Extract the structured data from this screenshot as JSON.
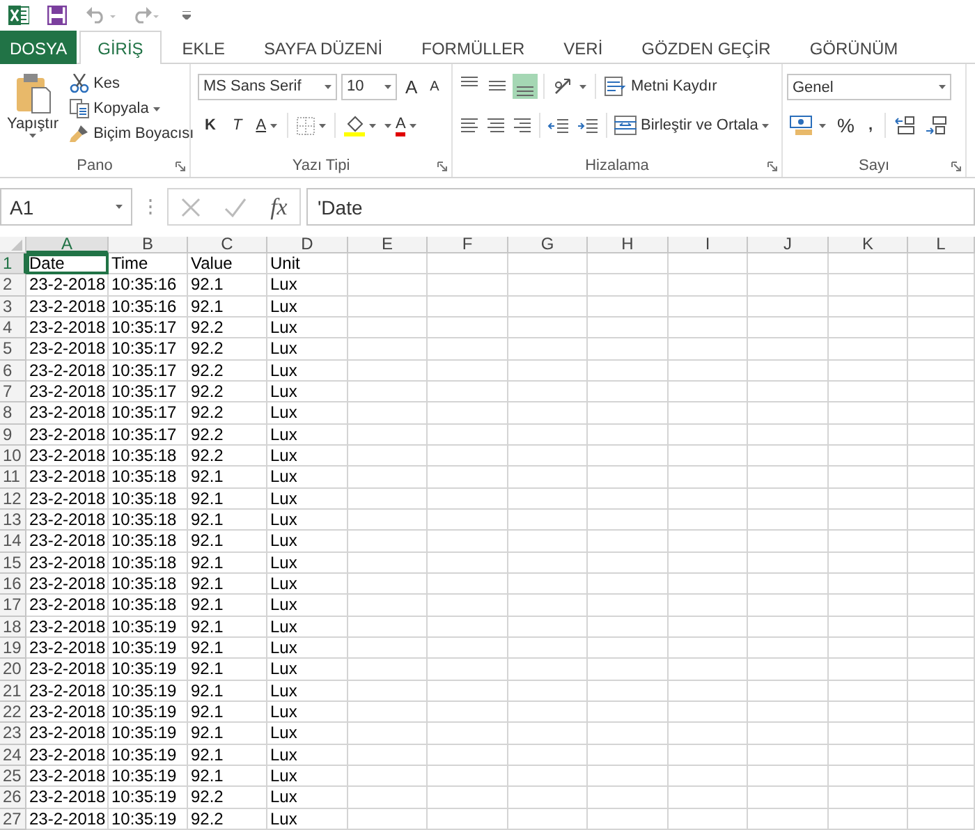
{
  "tabs": [
    {
      "label": "DOSYA",
      "kind": "file",
      "selected": false
    },
    {
      "label": "GİRİŞ",
      "kind": "tab",
      "selected": true
    },
    {
      "label": "EKLE",
      "kind": "tab",
      "selected": false
    },
    {
      "label": "SAYFA DÜZENİ",
      "kind": "tab",
      "selected": false
    },
    {
      "label": "FORMÜLLER",
      "kind": "tab",
      "selected": false
    },
    {
      "label": "VERİ",
      "kind": "tab",
      "selected": false
    },
    {
      "label": "GÖZDEN GEÇİR",
      "kind": "tab",
      "selected": false
    },
    {
      "label": "GÖRÜNÜM",
      "kind": "tab",
      "selected": false
    }
  ],
  "ribbon": {
    "clipboard": {
      "label": "Pano",
      "paste": "Yapıştır",
      "cut": "Kes",
      "copy": "Kopyala",
      "format_painter": "Biçim Boyacısı"
    },
    "font": {
      "label": "Yazı Tipi",
      "font_name": "MS Sans Serif",
      "font_size": "10",
      "grow_font": "A",
      "shrink_font": "A",
      "bold": "K",
      "italic": "T",
      "underline": "A",
      "font_color": "A"
    },
    "alignment": {
      "label": "Hizalama",
      "vertical_align": [
        {
          "kind": "top",
          "selected": false
        },
        {
          "kind": "middle",
          "selected": false
        },
        {
          "kind": "bottom",
          "selected": true
        }
      ],
      "wrap_text": "Metni Kaydır",
      "merge_center": "Birleştir ve Ortala"
    },
    "number": {
      "label": "Sayı",
      "format": "Genel",
      "percent": "%",
      "comma": ","
    }
  },
  "formula_bar": {
    "name_box": "A1",
    "function_label": "fx",
    "formula": "'Date"
  },
  "sheet": {
    "columns": [
      {
        "label": "A",
        "selected": true
      },
      {
        "label": "B",
        "selected": false
      },
      {
        "label": "C",
        "selected": false
      },
      {
        "label": "D",
        "selected": false
      },
      {
        "label": "E",
        "selected": false
      },
      {
        "label": "F",
        "selected": false
      },
      {
        "label": "G",
        "selected": false
      },
      {
        "label": "H",
        "selected": false
      },
      {
        "label": "I",
        "selected": false
      },
      {
        "label": "J",
        "selected": false
      },
      {
        "label": "K",
        "selected": false
      },
      {
        "label": "L",
        "selected": false
      }
    ],
    "rows": [
      {
        "number": "1",
        "selected": true,
        "cells": [
          "Date",
          "Time",
          "Value",
          "Unit"
        ]
      },
      {
        "number": "2",
        "selected": false,
        "cells": [
          "23-2-2018",
          "10:35:16",
          "92.1",
          "Lux"
        ]
      },
      {
        "number": "3",
        "selected": false,
        "cells": [
          "23-2-2018",
          "10:35:16",
          "92.1",
          "Lux"
        ]
      },
      {
        "number": "4",
        "selected": false,
        "cells": [
          "23-2-2018",
          "10:35:17",
          "92.2",
          "Lux"
        ]
      },
      {
        "number": "5",
        "selected": false,
        "cells": [
          "23-2-2018",
          "10:35:17",
          "92.2",
          "Lux"
        ]
      },
      {
        "number": "6",
        "selected": false,
        "cells": [
          "23-2-2018",
          "10:35:17",
          "92.2",
          "Lux"
        ]
      },
      {
        "number": "7",
        "selected": false,
        "cells": [
          "23-2-2018",
          "10:35:17",
          "92.2",
          "Lux"
        ]
      },
      {
        "number": "8",
        "selected": false,
        "cells": [
          "23-2-2018",
          "10:35:17",
          "92.2",
          "Lux"
        ]
      },
      {
        "number": "9",
        "selected": false,
        "cells": [
          "23-2-2018",
          "10:35:17",
          "92.2",
          "Lux"
        ]
      },
      {
        "number": "10",
        "selected": false,
        "cells": [
          "23-2-2018",
          "10:35:18",
          "92.2",
          "Lux"
        ]
      },
      {
        "number": "11",
        "selected": false,
        "cells": [
          "23-2-2018",
          "10:35:18",
          "92.1",
          "Lux"
        ]
      },
      {
        "number": "12",
        "selected": false,
        "cells": [
          "23-2-2018",
          "10:35:18",
          "92.1",
          "Lux"
        ]
      },
      {
        "number": "13",
        "selected": false,
        "cells": [
          "23-2-2018",
          "10:35:18",
          "92.1",
          "Lux"
        ]
      },
      {
        "number": "14",
        "selected": false,
        "cells": [
          "23-2-2018",
          "10:35:18",
          "92.1",
          "Lux"
        ]
      },
      {
        "number": "15",
        "selected": false,
        "cells": [
          "23-2-2018",
          "10:35:18",
          "92.1",
          "Lux"
        ]
      },
      {
        "number": "16",
        "selected": false,
        "cells": [
          "23-2-2018",
          "10:35:18",
          "92.1",
          "Lux"
        ]
      },
      {
        "number": "17",
        "selected": false,
        "cells": [
          "23-2-2018",
          "10:35:18",
          "92.1",
          "Lux"
        ]
      },
      {
        "number": "18",
        "selected": false,
        "cells": [
          "23-2-2018",
          "10:35:19",
          "92.1",
          "Lux"
        ]
      },
      {
        "number": "19",
        "selected": false,
        "cells": [
          "23-2-2018",
          "10:35:19",
          "92.1",
          "Lux"
        ]
      },
      {
        "number": "20",
        "selected": false,
        "cells": [
          "23-2-2018",
          "10:35:19",
          "92.1",
          "Lux"
        ]
      },
      {
        "number": "21",
        "selected": false,
        "cells": [
          "23-2-2018",
          "10:35:19",
          "92.1",
          "Lux"
        ]
      },
      {
        "number": "22",
        "selected": false,
        "cells": [
          "23-2-2018",
          "10:35:19",
          "92.1",
          "Lux"
        ]
      },
      {
        "number": "23",
        "selected": false,
        "cells": [
          "23-2-2018",
          "10:35:19",
          "92.1",
          "Lux"
        ]
      },
      {
        "number": "24",
        "selected": false,
        "cells": [
          "23-2-2018",
          "10:35:19",
          "92.1",
          "Lux"
        ]
      },
      {
        "number": "25",
        "selected": false,
        "cells": [
          "23-2-2018",
          "10:35:19",
          "92.1",
          "Lux"
        ]
      },
      {
        "number": "26",
        "selected": false,
        "cells": [
          "23-2-2018",
          "10:35:19",
          "92.2",
          "Lux"
        ]
      },
      {
        "number": "27",
        "selected": false,
        "cells": [
          "23-2-2018",
          "10:35:19",
          "92.2",
          "Lux"
        ]
      }
    ]
  }
}
